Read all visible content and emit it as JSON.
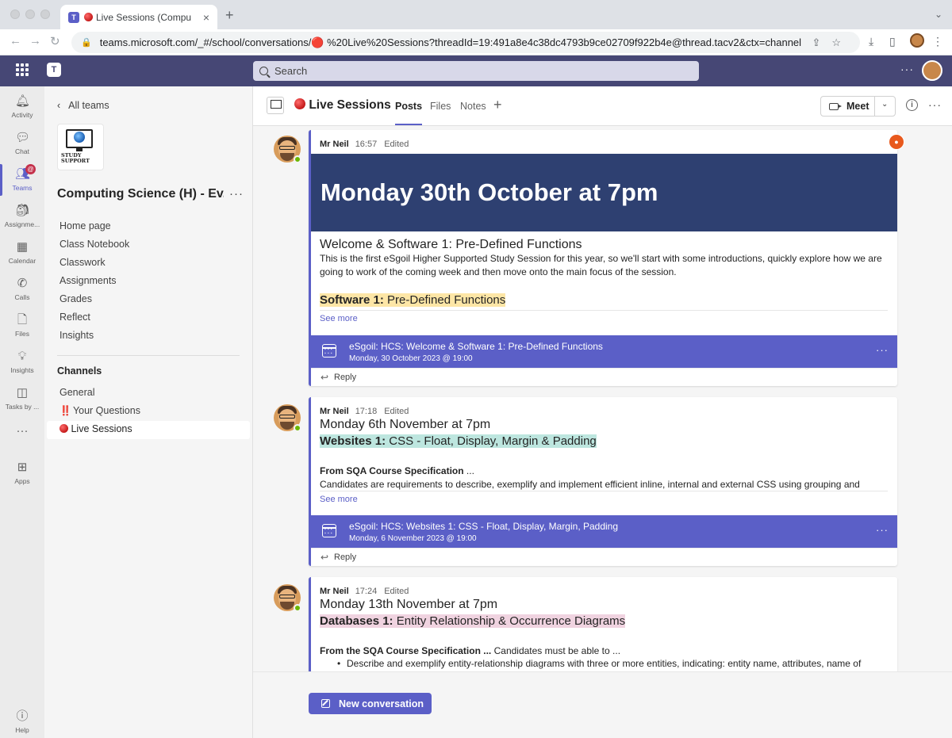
{
  "browser": {
    "tab_title": "Live Sessions (Computing",
    "tab_close": "×",
    "new_tab": "+",
    "url": "teams.microsoft.com/_#/school/conversations/🔴 %20Live%20Sessions?threadId=19:491a8e4c38dc4793b9ce02709f922b4e@thread.tacv2&ctx=channel"
  },
  "header": {
    "search_placeholder": "Search",
    "more": "···"
  },
  "rail": {
    "items": [
      {
        "label": "Activity",
        "icon": "bell-icon"
      },
      {
        "label": "Chat",
        "icon": "chat-icon"
      },
      {
        "label": "Teams",
        "icon": "teams-icon",
        "badge": "@"
      },
      {
        "label": "Assignme...",
        "icon": "assignments-icon"
      },
      {
        "label": "Calendar",
        "icon": "calendar-icon"
      },
      {
        "label": "Calls",
        "icon": "phone-icon"
      },
      {
        "label": "Files",
        "icon": "file-icon"
      },
      {
        "label": "Insights",
        "icon": "lightbulb-icon"
      },
      {
        "label": "Tasks by ...",
        "icon": "tasks-icon"
      },
      {
        "label": "Apps",
        "icon": "apps-icon"
      },
      {
        "label": "Help",
        "icon": "help-icon"
      }
    ],
    "more": "···"
  },
  "sidebar": {
    "all_teams": "All teams",
    "team_logo_text": "STUDY SUPPORT",
    "team_name": "Computing Science (H) - Ev...",
    "team_more": "···",
    "nav": [
      "Home page",
      "Class Notebook",
      "Classwork",
      "Assignments",
      "Grades",
      "Reflect",
      "Insights"
    ],
    "channels_heading": "Channels",
    "channels": [
      {
        "label": "General",
        "prefix": ""
      },
      {
        "label": "Your Questions",
        "prefix": "‼️"
      },
      {
        "label": "Live Sessions",
        "prefix": "red-dot"
      }
    ]
  },
  "channel": {
    "title": "Live Sessions",
    "tabs": [
      "Posts",
      "Files",
      "Notes"
    ],
    "add_tab": "+",
    "meet_label": "Meet",
    "info": "i",
    "more": "···"
  },
  "posts": [
    {
      "author": "Mr Neil",
      "time": "16:57",
      "edited": "Edited",
      "banner": "Monday 30th October at 7pm",
      "subject": "Welcome & Software 1: Pre-Defined Functions",
      "body": "This is the first eSgoil Higher Supported Study Session for this year, so we'll start with some introductions, quickly explore how we are going to work of the coming week and then move onto the main focus of the session.",
      "highlight_bold": "Software 1:",
      "highlight_rest": " Pre-Defined Functions",
      "see_more": "See more",
      "event_title": "eSgoil: HCS: Welcome & Software 1: Pre-Defined Functions",
      "event_date": "Monday, 30 October 2023 @ 19:00",
      "reply": "Reply"
    },
    {
      "author": "Mr Neil",
      "time": "17:18",
      "edited": "Edited",
      "subject": "Monday 6th November at 7pm",
      "highlight_bold": "Websites 1:",
      "highlight_rest": " CSS - Float, Display, Margin & Padding",
      "spec_bold": "From SQA Course Specification",
      "spec_rest": " ...",
      "body": "Candidates are requirements to describe, exemplify and implement efficient inline, internal and external CSS using grouping and",
      "see_more": "See more",
      "event_title": "eSgoil: HCS: Websites 1: CSS - Float, Display, Margin, Padding",
      "event_date": "Monday, 6 November 2023 @ 19:00",
      "reply": "Reply"
    },
    {
      "author": "Mr Neil",
      "time": "17:24",
      "edited": "Edited",
      "subject": "Monday 13th November at 7pm",
      "highlight_bold": "Databases 1:",
      "highlight_rest": " Entity Relationship & Occurrence Diagrams",
      "spec_bold": "From the SQA Course Specification ...",
      "spec_rest": " Candidates must be able to  ...",
      "bullet": "Describe and exemplify entity-relationship diagrams with three or more entities, indicating: entity name, attributes, name of"
    }
  ],
  "compose": {
    "new_conversation": "New conversation"
  },
  "colors": {
    "brand": "#5b5fc7",
    "header": "#464775",
    "banner": "#2e4071"
  }
}
